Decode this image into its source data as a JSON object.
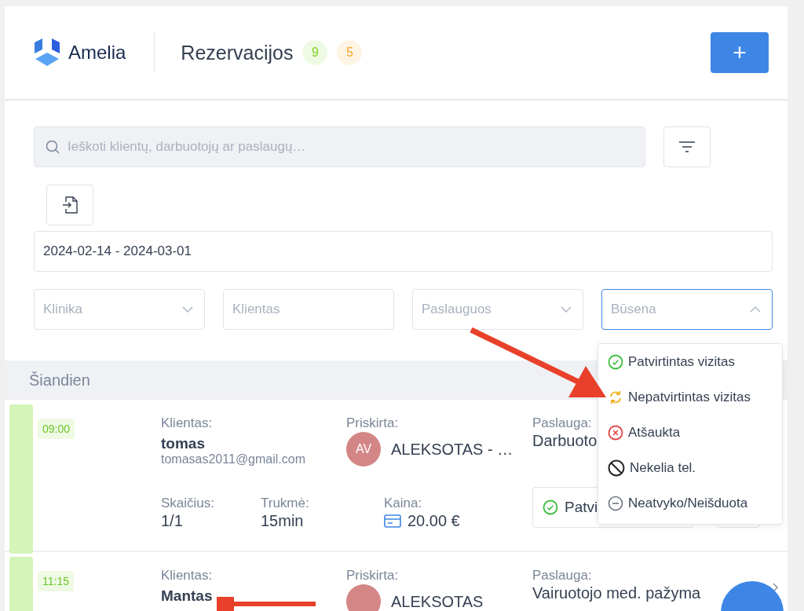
{
  "header": {
    "logo_text": "Amelia",
    "title": "Rezervacijos",
    "badges": [
      {
        "count": "9",
        "color": "#7ed321"
      },
      {
        "count": "5",
        "color": "#f5a623"
      }
    ],
    "add_button": "+"
  },
  "search": {
    "placeholder": "Ieškoti klientų, darbuotojų ar paslaugų…"
  },
  "date_range": {
    "value": "2024-02-14 - 2024-03-01"
  },
  "filters": [
    {
      "kind": "select",
      "placeholder": "Klinika",
      "open": false
    },
    {
      "kind": "input",
      "placeholder": "Klientas",
      "open": false
    },
    {
      "kind": "select",
      "placeholder": "Paslauguos",
      "open": false
    },
    {
      "kind": "select",
      "placeholder": "Būsena",
      "open": true
    }
  ],
  "status_menu": [
    {
      "kind": "approved",
      "label": "Patvirtintas vizitas"
    },
    {
      "kind": "pending",
      "label": "Nepatvirtintas vizitas"
    },
    {
      "kind": "canceled",
      "label": "Atšaukta"
    },
    {
      "kind": "rejected",
      "label": "Nekelia tel."
    },
    {
      "kind": "noshow",
      "label": "Neatvyko/Neišduota"
    }
  ],
  "day_label": "Šiandien",
  "appointments": [
    {
      "time": "09:00",
      "client_label": "Klientas:",
      "client_name": "tomas",
      "client_email": "tomasas2011@gmail.com",
      "assigned_label": "Priskirta:",
      "avatar": "AV",
      "assigned": "ALEKSOTAS - …",
      "service_label": "Paslauga:",
      "service": "Darbuoto",
      "count_label": "Skaičius:",
      "count": "1/1",
      "duration_label": "Trukmė:",
      "duration": "15min",
      "price_label": "Kaina:",
      "price": "20.00 €",
      "status": "Patvi"
    },
    {
      "time": "11:15",
      "client_label": "Klientas:",
      "client_name": "Mantas",
      "assigned_label": "Priskirta:",
      "assigned": "ALEKSOTAS",
      "service_label": "Paslauga:",
      "service": "Vairuotojo med. pažyma"
    }
  ]
}
